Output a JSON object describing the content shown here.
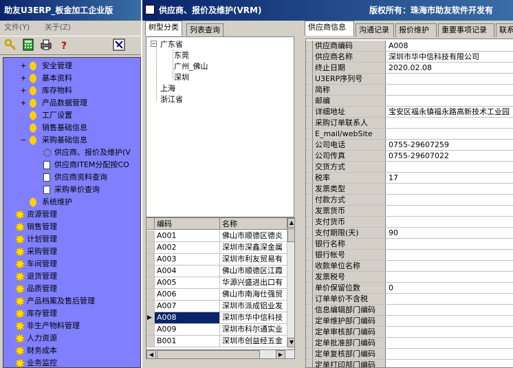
{
  "left_window": {
    "title": "助友U3ERP_板金加工企业版",
    "menu": [
      "文件(Y)",
      "关于(Z)"
    ],
    "toolbar_icons": [
      "key-icon",
      "calculator-icon",
      "printer-icon",
      "help-icon",
      "settings-icon"
    ],
    "help_glyph": "?",
    "tree": [
      {
        "label": "安全管理",
        "icon": "moon",
        "indent": 1,
        "pm": "+"
      },
      {
        "label": "基本资料",
        "icon": "moon",
        "indent": 1,
        "pm": "+"
      },
      {
        "label": "库存物料",
        "icon": "moon",
        "indent": 1,
        "pm": "+"
      },
      {
        "label": "产品数据管理",
        "icon": "moon",
        "indent": 1,
        "pm": "+"
      },
      {
        "label": "工厂设置",
        "icon": "moon",
        "indent": 1,
        "pm": ""
      },
      {
        "label": "销售基础信息",
        "icon": "moon",
        "indent": 1,
        "pm": ""
      },
      {
        "label": "采购基础信息",
        "icon": "moon",
        "indent": 1,
        "pm": "−"
      },
      {
        "label": "供应商、报价及维护(V",
        "icon": "gear",
        "indent": 2,
        "pm": ""
      },
      {
        "label": "供应商ITEM分配按CO",
        "icon": "doc",
        "indent": 2,
        "pm": ""
      },
      {
        "label": "供应商资料查询",
        "icon": "doc",
        "indent": 2,
        "pm": ""
      },
      {
        "label": "采购单价查询",
        "icon": "doc",
        "indent": 2,
        "pm": ""
      },
      {
        "label": "系统维护",
        "icon": "moon",
        "indent": 1,
        "pm": ""
      },
      {
        "label": "资源管理",
        "icon": "sun",
        "indent": 0,
        "pm": ""
      },
      {
        "label": "销售管理",
        "icon": "sun",
        "indent": 0,
        "pm": ""
      },
      {
        "label": "计划管理",
        "icon": "sun",
        "indent": 0,
        "pm": ""
      },
      {
        "label": "采购管理",
        "icon": "sun",
        "indent": 0,
        "pm": ""
      },
      {
        "label": "车间管理",
        "icon": "sun",
        "indent": 0,
        "pm": ""
      },
      {
        "label": "退货管理",
        "icon": "sun",
        "indent": 0,
        "pm": ""
      },
      {
        "label": "品质管理",
        "icon": "sun",
        "indent": 0,
        "pm": ""
      },
      {
        "label": "产品档案及售后管理",
        "icon": "sun",
        "indent": 0,
        "pm": ""
      },
      {
        "label": "库存管理",
        "icon": "sun",
        "indent": 0,
        "pm": ""
      },
      {
        "label": "非生产物料管理",
        "icon": "sun",
        "indent": 0,
        "pm": ""
      },
      {
        "label": "人力资源",
        "icon": "sun",
        "indent": 0,
        "pm": ""
      },
      {
        "label": "财务成本",
        "icon": "sun",
        "indent": 0,
        "pm": ""
      },
      {
        "label": "业务监控",
        "icon": "sun",
        "indent": 0,
        "pm": ""
      }
    ]
  },
  "main_window": {
    "title": "供应商、报价及维护(VRM)",
    "copyright": "版权所有：珠海市助友软件开发有",
    "left_tabs": [
      "树型分类",
      "列表查询"
    ],
    "right_tabs": [
      "供应商信息",
      "沟通记录",
      "报价维护",
      "重要事项记录",
      "联系"
    ],
    "region_tree": [
      {
        "label": "广东省",
        "level": 0,
        "pm": "−"
      },
      {
        "label": "东莞",
        "level": 1
      },
      {
        "label": "广州_佛山",
        "level": 1
      },
      {
        "label": "深圳",
        "level": 1
      },
      {
        "label": "上海",
        "level": 0
      },
      {
        "label": "浙江省",
        "level": 0
      }
    ],
    "grid": {
      "columns": [
        "编码",
        "名称"
      ],
      "selected_marker": "▶",
      "rows": [
        {
          "code": "A001",
          "name": "佛山市顺德区德炎"
        },
        {
          "code": "A002",
          "name": "深圳市深鑫深金属"
        },
        {
          "code": "A003",
          "name": "深圳市利友贸易有"
        },
        {
          "code": "A004",
          "name": "佛山市顺德区江霞"
        },
        {
          "code": "A005",
          "name": "华源兴盛进出口有"
        },
        {
          "code": "A006",
          "name": "佛山市南海仕强贸"
        },
        {
          "code": "A007",
          "name": "深圳市派成铝业发"
        },
        {
          "code": "A008",
          "name": "深圳市华中信科技",
          "selected": true
        },
        {
          "code": "A009",
          "name": "深圳市科尔通实业"
        },
        {
          "code": "B001",
          "name": "深圳市创益经五金"
        }
      ]
    },
    "supplier_info": [
      {
        "label": "供应商编码",
        "value": "A008"
      },
      {
        "label": "供应商名称",
        "value": "深圳市华中信科技有限公司"
      },
      {
        "label": "终止日期",
        "value": "2020.02.08"
      },
      {
        "label": "U3ERP序列号",
        "value": ""
      },
      {
        "label": "简称",
        "value": ""
      },
      {
        "label": "邮编",
        "value": ""
      },
      {
        "label": "详细地址",
        "value": "宝安区福永镇福永路高新技术工业园"
      },
      {
        "label": "采购订单联系人",
        "value": ""
      },
      {
        "label": "E_mail/webSite",
        "value": ""
      },
      {
        "label": "公司电话",
        "value": "0755-29607259"
      },
      {
        "label": "公司传真",
        "value": "0755-29607022"
      },
      {
        "label": "交货方式",
        "value": ""
      },
      {
        "label": "税率",
        "value": "17"
      },
      {
        "label": "发票类型",
        "value": ""
      },
      {
        "label": "付款方式",
        "value": ""
      },
      {
        "label": "发票货币",
        "value": ""
      },
      {
        "label": "支付货币",
        "value": ""
      },
      {
        "label": "支付期限(天)",
        "value": "90"
      },
      {
        "label": "银行名称",
        "value": ""
      },
      {
        "label": "银行帐号",
        "value": ""
      },
      {
        "label": "收款单位名称",
        "value": ""
      },
      {
        "label": "发票税号",
        "value": ""
      },
      {
        "label": "单价保留位数",
        "value": "0"
      },
      {
        "label": "订单单价不含税",
        "value": ""
      },
      {
        "label": "信息编辑部门编码",
        "value": ""
      },
      {
        "label": "定单维护部门编码",
        "value": ""
      },
      {
        "label": "定单审核部门编码",
        "value": ""
      },
      {
        "label": "定单批准部门编码",
        "value": ""
      },
      {
        "label": "定单复核部门编码",
        "value": ""
      },
      {
        "label": "定单打印部门编码",
        "value": ""
      }
    ]
  },
  "colors": {
    "titlebar": "#0a246a",
    "tree_bg": "#8080ff",
    "selection": "#0a246a"
  }
}
